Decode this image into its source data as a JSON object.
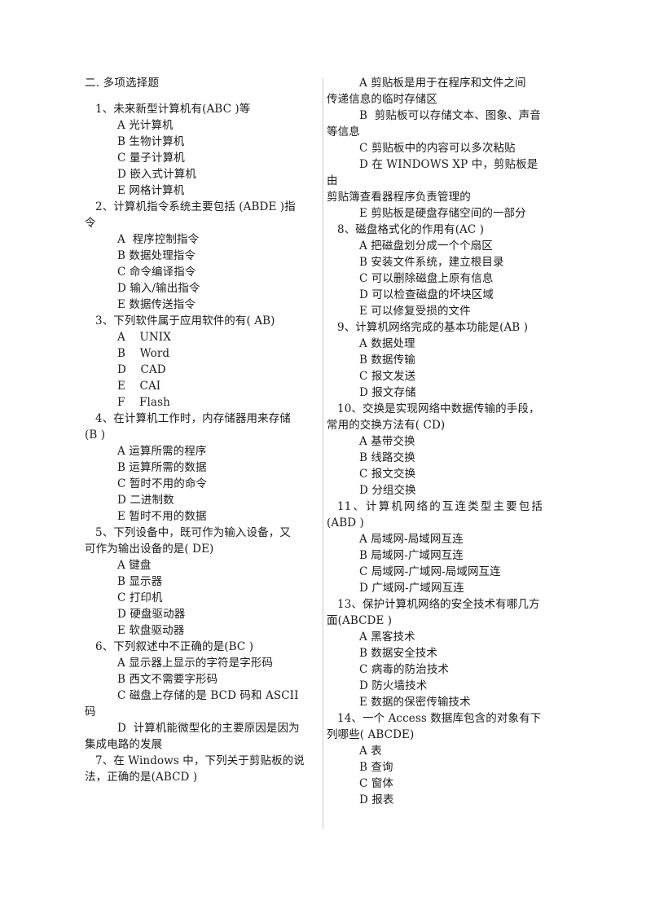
{
  "document": {
    "section_title": "二. 多项选择题"
  },
  "left_column": [
    {
      "number": "1、",
      "stem": "未来新型计算机有(ABC )等",
      "stem_cont": [],
      "options": [
        "A 光计算机",
        "B 生物计算机",
        "C 量子计算机",
        "D 嵌入式计算机",
        "E 网格计算机"
      ]
    },
    {
      "number": "2、",
      "stem": "计算机指令系统主要包括 (ABDE )指",
      "stem_cont": [
        "令"
      ],
      "options": [
        "A  程序控制指令",
        "B 数据处理指令",
        "C 命令编译指令",
        "D 输入/输出指令",
        "E 数据传送指令"
      ]
    },
    {
      "number": "3、",
      "stem": "下列软件属于应用软件的有( AB)",
      "stem_cont": [],
      "options": [
        "A    UNIX",
        "B    Word",
        "D    CAD",
        "E    CAI",
        "F    Flash"
      ]
    },
    {
      "number": "4、",
      "stem": "在计算机工作时，内存储器用来存储",
      "stem_cont": [
        "(B )"
      ],
      "options": [
        "A 运算所需的程序",
        "B 运算所需的数据",
        "C 暂时不用的命令",
        "D 二进制数",
        "E 暂时不用的数据"
      ]
    },
    {
      "number": "5、",
      "stem": "下列设备中，既可作为输入设备，又",
      "stem_cont": [
        "可作为输出设备的是( DE)"
      ],
      "options": [
        "A 键盘",
        "B 显示器",
        "C 打印机",
        "D 硬盘驱动器",
        "E 软盘驱动器"
      ]
    },
    {
      "number": "6、",
      "stem": "下列叙述中不正确的是(BC )",
      "stem_cont": [],
      "options": [
        "A 显示器上显示的字符是字形码",
        "B 西文不需要字形码",
        "C 磁盘上存储的是 BCD 码和 ASCII",
        "码",
        "D  计算机能微型化的主要原因是因为",
        "集成电路的发展"
      ]
    },
    {
      "number": "7、",
      "stem": "在 Windows 中，下列关于剪贴板的说",
      "stem_cont": [
        "法，正确的是(ABCD )"
      ],
      "options": []
    }
  ],
  "right_column": [
    {
      "number": "",
      "stem": "",
      "stem_cont": [],
      "options": [
        "A 剪贴板是用于在程序和文件之间",
        "传递信息的临时存储区",
        "B  剪贴板可以存储文本、图象、声音",
        "等信息",
        "C 剪贴板中的内容可以多次粘贴",
        "D 在 WINDOWS XP 中，剪贴板是由",
        "剪贴簿查看器程序负责管理的",
        "E 剪贴板是硬盘存储空间的一部分"
      ]
    },
    {
      "number": "8、",
      "stem": "磁盘格式化的作用有(AC )",
      "stem_cont": [],
      "options": [
        "A 把磁盘划分成一个个扇区",
        "B 安装文件系统，建立根目录",
        "C 可以删除磁盘上原有信息",
        "D 可以检查磁盘的坏块区域",
        "E 可以修复受损的文件"
      ]
    },
    {
      "number": "9、",
      "stem": "计算机网络完成的基本功能是(AB )",
      "stem_cont": [],
      "options": [
        "A 数据处理",
        "B 数据传输",
        "C 报文发送",
        "D 报文存储"
      ]
    },
    {
      "number": "10、",
      "stem": "交换是实现网络中数据传输的手段，",
      "stem_cont": [
        "常用的交换方法有( CD)"
      ],
      "options": [
        "A 基带交换",
        "B 线路交换",
        "C 报文交换",
        "D 分组交换"
      ]
    },
    {
      "number": "11、",
      "stem": "计算机网络的互连类型主要包括",
      "stem_cont": [
        "(ABD )"
      ],
      "stem_justify": true,
      "options": [
        "A 局域网-局域网互连",
        "B 局域网-广域网互连",
        "C 局域网-广域网-局域网互连",
        "D 广域网-广域网互连"
      ]
    },
    {
      "number": "13、",
      "stem": "保护计算机网络的安全技术有哪几方",
      "stem_cont": [
        "面(ABCDE )"
      ],
      "options": [
        "A 黑客技术",
        "B 数据安全技术",
        "C 病毒的防治技术",
        "D 防火墙技术",
        "E 数据的保密传输技术"
      ]
    },
    {
      "number": "14、",
      "stem": "一个 Access 数据库包含的对象有下",
      "stem_cont": [
        "列哪些( ABCDE)"
      ],
      "options": [
        "A 表",
        "B 查询",
        "C 窗体",
        "D 报表"
      ]
    }
  ]
}
